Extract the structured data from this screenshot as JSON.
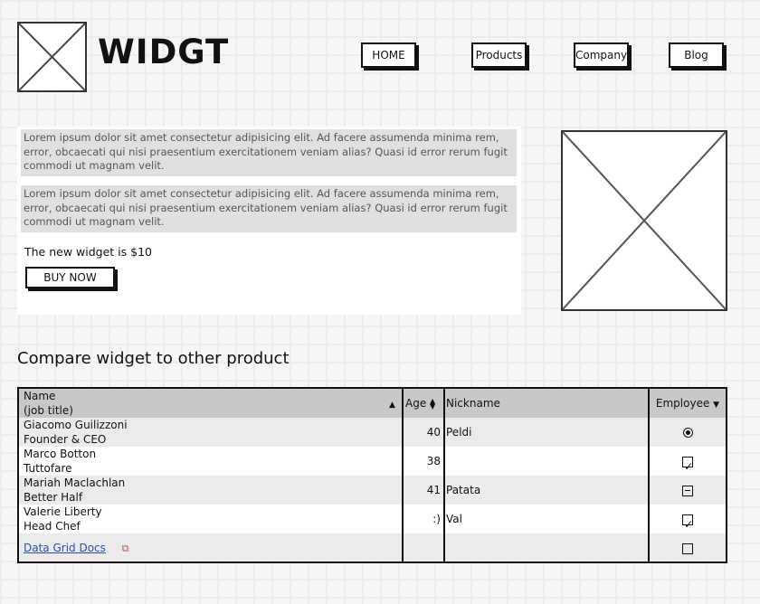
{
  "header": {
    "brand": "WIDGT",
    "logo_icon": "image-placeholder-icon",
    "nav": [
      {
        "label": "HOME"
      },
      {
        "label": "Products"
      },
      {
        "label": "Company"
      },
      {
        "label": "Blog"
      }
    ]
  },
  "content": {
    "para1": "Lorem ipsum dolor sit amet consectetur adipisicing elit. Ad facere assumenda minima rem, error, obcaecati qui nisi praesentium exercitationem veniam alias? Quasi id error rerum fugit commodi ut magnam velit.",
    "para2": "Lorem ipsum dolor sit amet consectetur adipisicing elit. Ad facere assumenda minima rem, error, obcaecati qui nisi praesentium exercitationem veniam alias? Quasi id error rerum fugit commodi ut magnam velit.",
    "price_text": "The new widget is $10",
    "buy_label": "BUY NOW",
    "side_image_icon": "image-placeholder-icon"
  },
  "compare": {
    "heading": "Compare widget to other product",
    "columns": {
      "name_line1": "Name",
      "name_line2": "(job title)",
      "age": "Age",
      "nickname": "Nickname",
      "employee": "Employee"
    },
    "rows": [
      {
        "name": "Giacomo Guilizzoni",
        "title": "Founder & CEO",
        "age": "40",
        "nickname": "Peldi",
        "employee": "radio-selected"
      },
      {
        "name": "Marco Botton",
        "title": "Tuttofare",
        "age": "38",
        "nickname": "",
        "employee": "checked"
      },
      {
        "name": "Mariah Maclachlan",
        "title": "Better Half",
        "age": "41",
        "nickname": "Patata",
        "employee": "partial"
      },
      {
        "name": "Valerie Liberty",
        "title": "Head Chef",
        "age": ":)",
        "nickname": "Val",
        "employee": "checked"
      }
    ],
    "footer_link": "Data Grid Docs",
    "footer_link_icon": "external-link-icon",
    "footer_employee": "unchecked"
  }
}
